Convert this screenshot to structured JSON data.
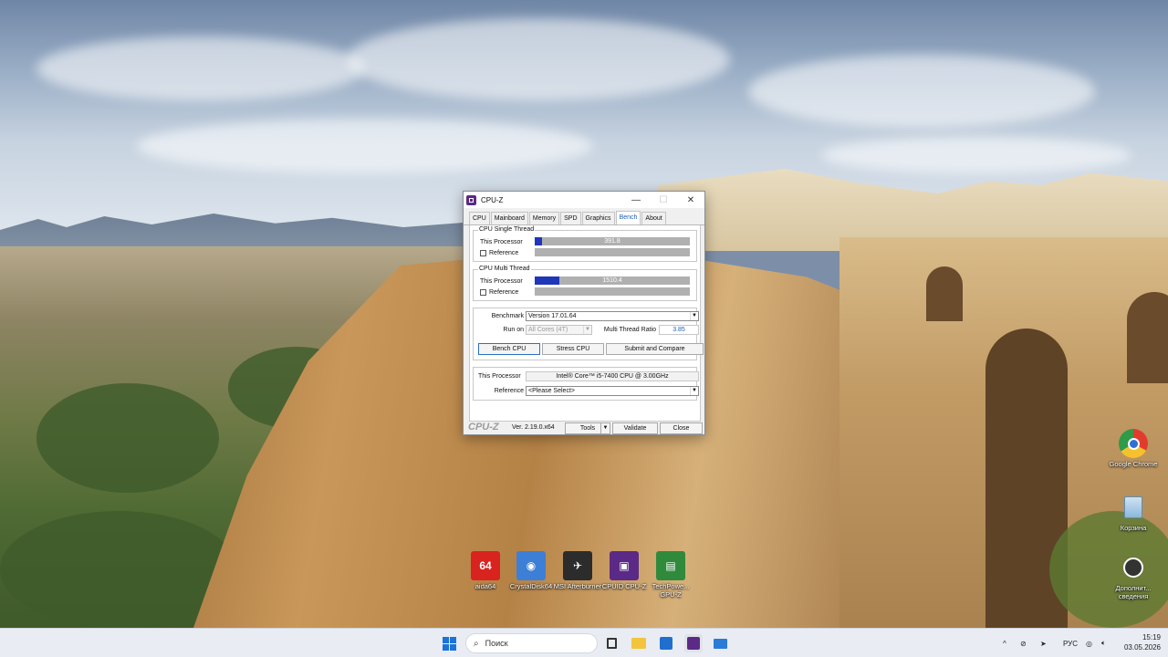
{
  "window": {
    "title": "CPU-Z",
    "minimize": "—",
    "maximize": "☐",
    "close": "✕"
  },
  "tabs": [
    "CPU",
    "Mainboard",
    "Memory",
    "SPD",
    "Graphics",
    "Bench",
    "About"
  ],
  "active_tab": "Bench",
  "single_thread": {
    "group_title": "CPU Single Thread",
    "this_label": "This Processor",
    "this_value": "391.8",
    "this_fraction": 0.045,
    "reference_label": "Reference"
  },
  "multi_thread": {
    "group_title": "CPU Multi Thread",
    "this_label": "This Processor",
    "this_value": "1510.4",
    "this_fraction": 0.16,
    "reference_label": "Reference"
  },
  "bench": {
    "benchmark_label": "Benchmark",
    "benchmark_value": "Version 17.01.64",
    "run_on_label": "Run on",
    "run_on_value": "All Cores (4T)",
    "ratio_label": "Multi Thread Ratio",
    "ratio_value": "3.85",
    "bench_button": "Bench CPU",
    "stress_button": "Stress CPU",
    "submit_button": "Submit and Compare"
  },
  "processor": {
    "this_label": "This Processor",
    "this_value": "Intel® Core™ i5-7400 CPU @ 3.00GHz",
    "reference_label": "Reference",
    "reference_value": "<Please Select>"
  },
  "footer": {
    "brand": "CPU-Z",
    "version": "Ver. 2.19.0.x64",
    "tools_button": "Tools",
    "validate_button": "Validate",
    "close_button": "Close"
  },
  "desktop_icons": [
    {
      "label": "aida64",
      "glyph": "64",
      "color": "#d8231f"
    },
    {
      "label": "CrystalDisk64",
      "glyph": "◉",
      "color": "#3d7fd6"
    },
    {
      "label": "MSI Afterburner",
      "glyph": "✈",
      "color": "#2c2c2c"
    },
    {
      "label": "CPUID CPU-Z",
      "glyph": "▣",
      "color": "#5b2a86"
    },
    {
      "label": "TechPowe... GPU-Z",
      "glyph": "▤",
      "color": "#2f8a3c"
    }
  ],
  "right_icons": [
    {
      "label": "Google Chrome",
      "color": "#e23b2e"
    },
    {
      "label": "Корзина",
      "color": "#6aa7d8"
    },
    {
      "label": "Дополнит... сведения",
      "color": "#333333"
    }
  ],
  "taskbar": {
    "search_placeholder": "Поиск",
    "language": "РУС",
    "time": "15:19",
    "date": "03.05.2026",
    "chevron": "^"
  }
}
